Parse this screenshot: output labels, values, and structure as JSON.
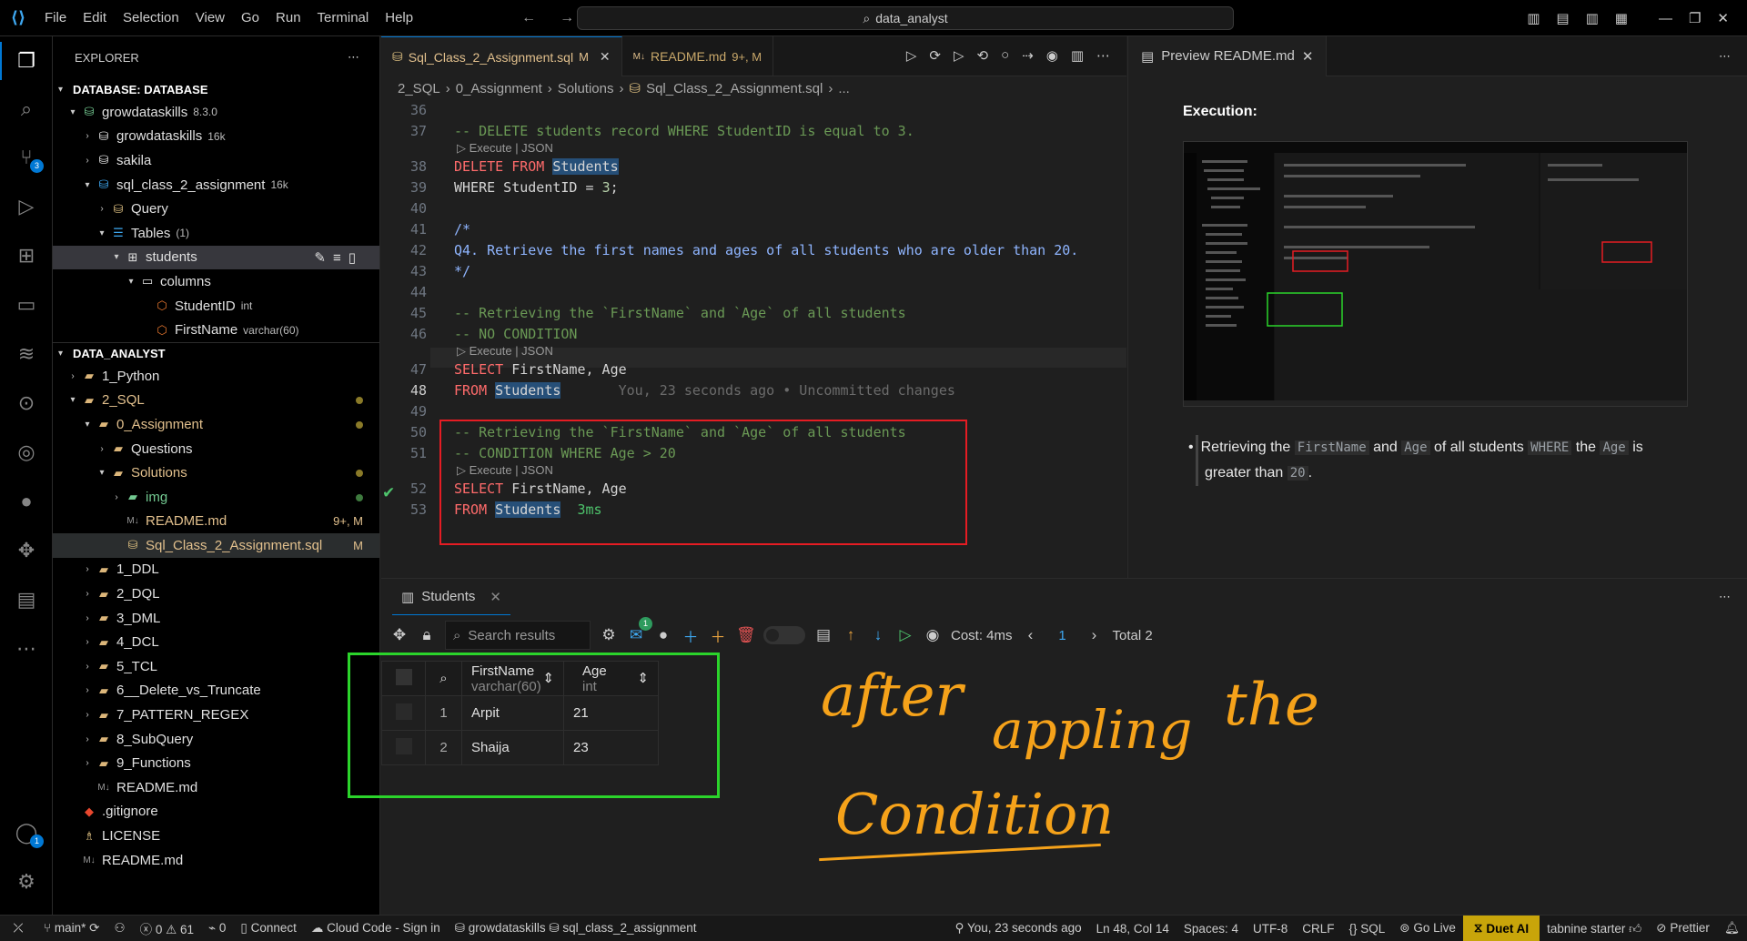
{
  "titlebar": {
    "menu": [
      "File",
      "Edit",
      "Selection",
      "View",
      "Go",
      "Run",
      "Terminal",
      "Help"
    ],
    "search": "data_analyst"
  },
  "activity_badges": {
    "source_control": "3",
    "accounts": "1"
  },
  "sidebar": {
    "header": "EXPLORER",
    "db_section": "DATABASE: DATABASE",
    "db_rows": [
      {
        "label": "growdataskills",
        "meta": "8.3.0"
      },
      {
        "label": "growdataskills",
        "meta": "16k"
      },
      {
        "label": "sakila",
        "meta": ""
      },
      {
        "label": "sql_class_2_assignment",
        "meta": "16k"
      },
      {
        "label": "Query",
        "meta": ""
      },
      {
        "label": "Tables",
        "meta": "(1)"
      },
      {
        "label": "students",
        "meta": ""
      },
      {
        "label": "columns",
        "meta": ""
      },
      {
        "label": "StudentID",
        "meta": "int"
      },
      {
        "label": "FirstName",
        "meta": "varchar(60)"
      }
    ],
    "folder_section": "DATA_ANALYST",
    "files": [
      {
        "label": "1_Python",
        "right": ""
      },
      {
        "label": "2_SQL",
        "right": ""
      },
      {
        "label": "0_Assignment",
        "right": ""
      },
      {
        "label": "Questions",
        "right": ""
      },
      {
        "label": "Solutions",
        "right": ""
      },
      {
        "label": "img",
        "right": ""
      },
      {
        "label": "README.md",
        "right": "9+, M"
      },
      {
        "label": "Sql_Class_2_Assignment.sql",
        "right": "M"
      },
      {
        "label": "1_DDL",
        "right": ""
      },
      {
        "label": "2_DQL",
        "right": ""
      },
      {
        "label": "3_DML",
        "right": ""
      },
      {
        "label": "4_DCL",
        "right": ""
      },
      {
        "label": "5_TCL",
        "right": ""
      },
      {
        "label": "6__Delete_vs_Truncate",
        "right": ""
      },
      {
        "label": "7_PATTERN_REGEX",
        "right": ""
      },
      {
        "label": "8_SubQuery",
        "right": ""
      },
      {
        "label": "9_Functions",
        "right": ""
      },
      {
        "label": "README.md",
        "right": ""
      },
      {
        "label": ".gitignore",
        "right": ""
      },
      {
        "label": "LICENSE",
        "right": ""
      },
      {
        "label": "README.md",
        "right": ""
      }
    ]
  },
  "editor": {
    "tabs": [
      {
        "label": "Sql_Class_2_Assignment.sql",
        "status": "M"
      },
      {
        "label": "README.md",
        "status": "9+, M"
      }
    ],
    "breadcrumb": [
      "2_SQL",
      "0_Assignment",
      "Solutions",
      "Sql_Class_2_Assignment.sql",
      "..."
    ],
    "line_numbers": [
      "36",
      "37",
      "38",
      "39",
      "40",
      "41",
      "42",
      "43",
      "44",
      "45",
      "46",
      "47",
      "48",
      "49",
      "50",
      "51",
      "52",
      "53"
    ],
    "codelens": "Execute | JSON",
    "lines": {
      "l37": "-- DELETE students record WHERE StudentID is equal to 3.",
      "l38a": "DELETE FROM ",
      "l38b": "Students",
      "l39a": "WHERE StudentID = ",
      "l39b": "3",
      "l39c": ";",
      "l41": "/*",
      "l42": "Q4. Retrieve the first names and ages of all students who are older than 20.",
      "l43": "*/",
      "l45": "-- Retrieving the `FirstName` and `Age` of all students",
      "l46": "-- NO CONDITION",
      "l47a": "SELECT",
      "l47b": " FirstName, Age",
      "l48a": "FROM ",
      "l48b": "Students",
      "l48ghost": "You, 23 seconds ago • Uncommitted changes",
      "l50": "-- Retrieving the `FirstName` and `Age` of all students",
      "l51": "-- CONDITION WHERE Age > 20",
      "l52a": "SELECT",
      "l52b": " FirstName, Age",
      "l53a": "FROM ",
      "l53b": "Students",
      "l53c": "3ms"
    }
  },
  "preview": {
    "tab": "Preview README.md",
    "heading": "Execution:",
    "bullet": {
      "t1": "Retrieving the ",
      "c1": "FirstName",
      "t2": " and ",
      "c2": "Age",
      "t3": " of all students ",
      "c3": "WHERE",
      "t4": " the ",
      "c4": "Age",
      "t5": " is greater than ",
      "c5": "20",
      "t6": "."
    }
  },
  "panel": {
    "tab": "Students",
    "search_placeholder": "Search results",
    "mail_badge": "1",
    "cost": "Cost: 4ms",
    "page": "1",
    "total": "Total 2",
    "columns": [
      {
        "name": "FirstName",
        "type": "varchar(60)"
      },
      {
        "name": "Age",
        "type": "int"
      }
    ],
    "rows": [
      {
        "n": "1",
        "first": "Arpit",
        "age": "21"
      },
      {
        "n": "2",
        "first": "Shaija",
        "age": "23"
      }
    ],
    "annotation": [
      "after",
      "appling",
      "the",
      "Condition"
    ]
  },
  "status": {
    "branch": "main*",
    "errors": "0",
    "warnings": "61",
    "ports": "0",
    "connect": "Connect",
    "cloud": "Cloud Code - Sign in",
    "db": "growdataskills",
    "schema": "sql_class_2_assignment",
    "blame": "You, 23 seconds ago",
    "pos": "Ln 48, Col 14",
    "spaces": "Spaces: 4",
    "enc": "UTF-8",
    "eol": "CRLF",
    "lang": "SQL",
    "golive": "Go Live",
    "duet": "Duet AI",
    "tabnine": "tabnine starter",
    "prettier": "Prettier"
  },
  "colors": {
    "accent": "#0078d4",
    "highlight_red": "#e51c23",
    "highlight_green": "#2bd42b",
    "annotation": "#f5a21a"
  }
}
